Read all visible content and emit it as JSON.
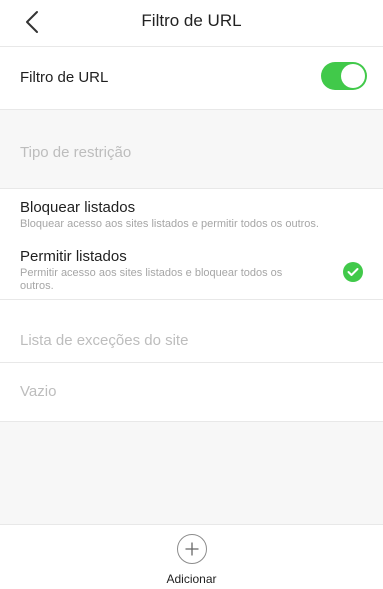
{
  "header": {
    "title": "Filtro de URL",
    "back_icon": "chevron-left-icon"
  },
  "filter_toggle": {
    "label": "Filtro de URL",
    "enabled": true
  },
  "restriction_section": {
    "header": "Tipo de restrição",
    "options": [
      {
        "title": "Bloquear listados",
        "description": "Bloquear acesso aos sites listados e permitir todos os outros.",
        "selected": false
      },
      {
        "title": "Permitir listados",
        "description": "Permitir acesso aos sites listados e bloquear todos os outros.",
        "selected": true
      }
    ]
  },
  "exceptions_section": {
    "header": "Lista de exceções do site",
    "empty_text": "Vazio"
  },
  "footer": {
    "add_label": "Adicionar",
    "add_icon": "plus-circle-icon"
  },
  "colors": {
    "accent_green": "#41c94a",
    "placeholder_grey": "#bdbdbd",
    "section_bg": "#f7f7f7"
  }
}
